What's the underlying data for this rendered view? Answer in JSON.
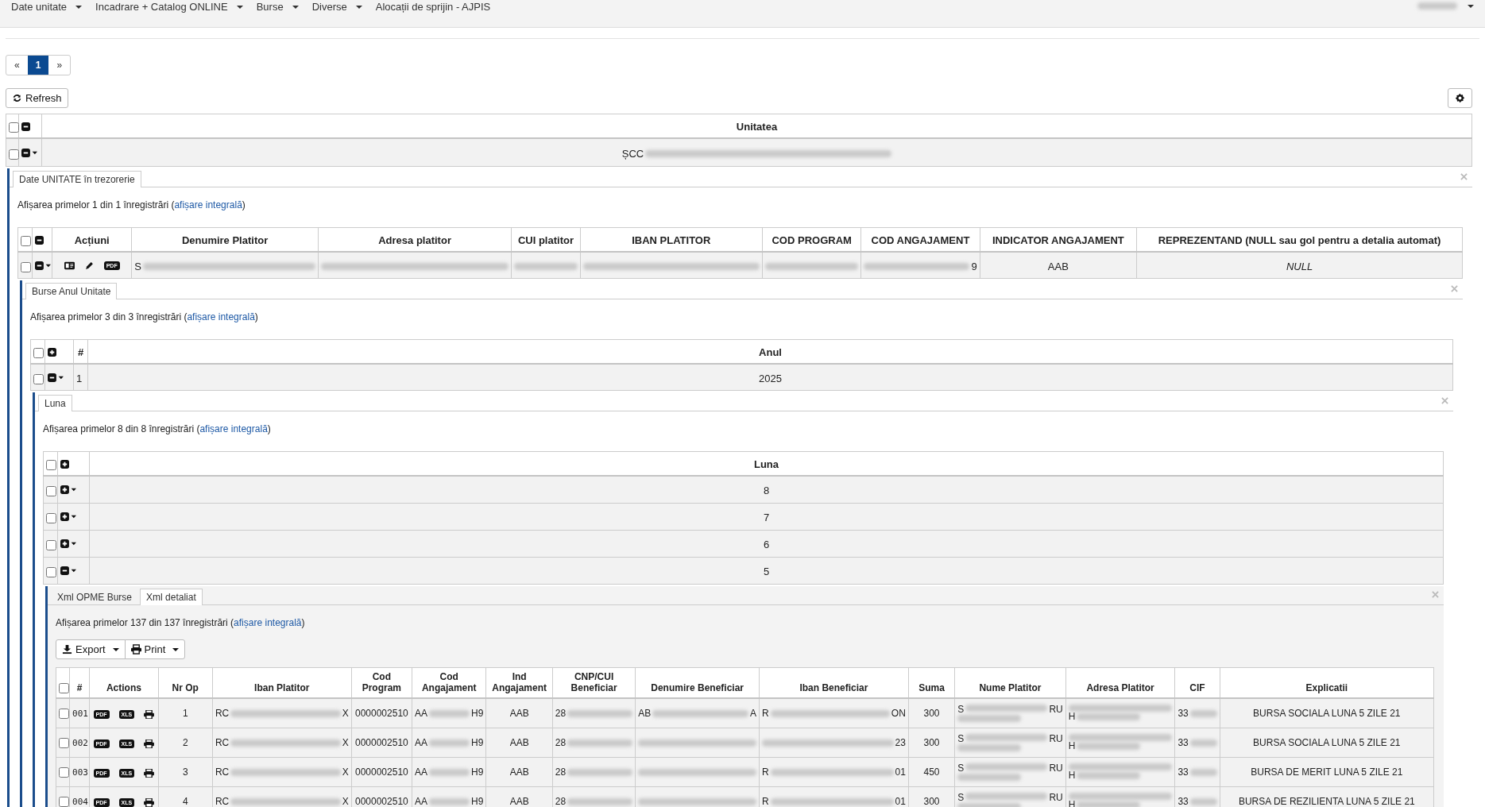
{
  "nav": {
    "items": [
      {
        "label": "Date unitate",
        "dropdown": true
      },
      {
        "label": "Incadrare + Catalog ONLINE",
        "dropdown": true
      },
      {
        "label": "Burse",
        "dropdown": true
      },
      {
        "label": "Diverse",
        "dropdown": true
      },
      {
        "label": "Alocații de sprijin - AJPIS",
        "dropdown": false
      }
    ],
    "user_menu": {
      "dropdown": true
    }
  },
  "pagination": {
    "prev": "«",
    "pages": [
      {
        "label": "1",
        "selected": true
      }
    ],
    "next": "»"
  },
  "toolbar": {
    "refresh": "Refresh"
  },
  "units_table": {
    "header_checked": false,
    "all_expanded": true,
    "columns": [
      "Unitatea"
    ],
    "rows": [
      {
        "checked": false,
        "expanded": true,
        "cells": [
          {
            "kind": "redacted",
            "pre": "ȘCC"
          }
        ]
      }
    ]
  },
  "unit_panel": {
    "tabs": [
      {
        "label": "Date UNITATE în trezorerie",
        "selected": true
      }
    ],
    "summary": {
      "before": "Afișarea primelor 1 din 1 înregistrări (",
      "link": "afișare integrală",
      "after": ")"
    },
    "table": {
      "header_checked": false,
      "all_expanded": true,
      "columns": [
        "Acțiuni",
        "Denumire Platitor",
        "Adresa platitor",
        "CUI platitor",
        "IBAN PLATITOR",
        "COD PROGRAM",
        "COD ANGAJAMENT",
        "INDICATOR ANGAJAMENT",
        "REPREZENTAND (NULL sau gol pentru a detalia automat)"
      ],
      "rows": [
        {
          "checked": false,
          "expanded": true,
          "cells": [
            {
              "kind": "actions",
              "actions": [
                {
                  "kind": "card"
                },
                {
                  "kind": "edit"
                },
                {
                  "kind": "badge",
                  "label": "PDF"
                }
              ]
            },
            {
              "kind": "redacted",
              "pre": "S"
            },
            {
              "kind": "redacted"
            },
            {
              "kind": "redacted"
            },
            {
              "kind": "redacted"
            },
            {
              "kind": "redacted"
            },
            {
              "kind": "redacted",
              "post": "9"
            },
            {
              "kind": "text",
              "text": "AAB"
            },
            {
              "kind": "null",
              "text": "NULL"
            }
          ]
        }
      ]
    },
    "year_panel": {
      "tabs": [
        {
          "label": "Burse Anul Unitate",
          "selected": true
        }
      ],
      "summary": {
        "before": "Afișarea primelor 3 din 3 înregistrări (",
        "link": "afișare integrală",
        "after": ")"
      },
      "table": {
        "header_checked": false,
        "all_expanded": false,
        "columns": [
          "#",
          "Anul"
        ],
        "rows": [
          {
            "checked": false,
            "expanded": true,
            "cells": [
              "1",
              "2025"
            ]
          }
        ]
      },
      "month_panel": {
        "tabs": [
          {
            "label": "Luna",
            "selected": true
          }
        ],
        "summary": {
          "before": "Afișarea primelor 8 din 8 înregistrări (",
          "link": "afișare integrală",
          "after": ")"
        },
        "table": {
          "header_checked": false,
          "all_expanded": false,
          "columns": [
            "Luna"
          ],
          "rows": [
            {
              "checked": false,
              "expanded": false,
              "cells": [
                "8"
              ]
            },
            {
              "checked": false,
              "expanded": false,
              "cells": [
                "7"
              ]
            },
            {
              "checked": false,
              "expanded": false,
              "cells": [
                "6"
              ]
            },
            {
              "checked": false,
              "expanded": true,
              "cells": [
                "5"
              ]
            }
          ]
        },
        "xml_panel": {
          "tabs": [
            {
              "label": "Xml OPME Burse",
              "selected": false
            },
            {
              "label": "Xml detaliat",
              "selected": true
            }
          ],
          "summary": {
            "before": "Afișarea primelor 137 din 137 înregistrări (",
            "link": "afișare integrală",
            "after": ")"
          },
          "buttons": [
            {
              "kind": "export",
              "label": "Export"
            },
            {
              "kind": "print",
              "label": "Print"
            }
          ],
          "table": {
            "header_checked": false,
            "columns": [
              "#",
              "Actions",
              "Nr Op",
              "Iban Platitor",
              "Cod Program",
              "Cod Angajament",
              "Ind Angajament",
              "CNP/CUI Beneficiar",
              "Denumire Beneficiar",
              "Iban Beneficiar",
              "Suma",
              "Nume Platitor",
              "Adresa Platitor",
              "CIF",
              "Explicatii"
            ],
            "rows": [
              {
                "checked": false,
                "cells": [
                  {
                    "kind": "index",
                    "text": "001"
                  },
                  {
                    "kind": "actions",
                    "actions": [
                      {
                        "kind": "badge",
                        "label": "PDF"
                      },
                      {
                        "kind": "badge",
                        "label": "XLS"
                      },
                      {
                        "kind": "print"
                      }
                    ]
                  },
                  {
                    "kind": "text",
                    "text": "1"
                  },
                  {
                    "kind": "redacted",
                    "pre": "RC",
                    "post": "X"
                  },
                  {
                    "kind": "text",
                    "text": "0000002510"
                  },
                  {
                    "kind": "redacted",
                    "pre": "AA",
                    "post": "H9"
                  },
                  {
                    "kind": "text",
                    "text": "AAB"
                  },
                  {
                    "kind": "redacted",
                    "pre": "28"
                  },
                  {
                    "kind": "redacted",
                    "pre": "AB",
                    "post": "A"
                  },
                  {
                    "kind": "redacted",
                    "pre": "R",
                    "post": "ON"
                  },
                  {
                    "kind": "text",
                    "text": "300"
                  },
                  {
                    "kind": "redacted_two_line",
                    "pre": "S",
                    "post": "RU"
                  },
                  {
                    "kind": "redacted_two_line",
                    "pre2": "H"
                  },
                  {
                    "kind": "redacted",
                    "pre": "33"
                  },
                  {
                    "kind": "text",
                    "text": "BURSA SOCIALA LUNA 5 ZILE 21"
                  }
                ]
              },
              {
                "checked": false,
                "cells": [
                  {
                    "kind": "index",
                    "text": "002"
                  },
                  {
                    "kind": "actions",
                    "actions": [
                      {
                        "kind": "badge",
                        "label": "PDF"
                      },
                      {
                        "kind": "badge",
                        "label": "XLS"
                      },
                      {
                        "kind": "print"
                      }
                    ]
                  },
                  {
                    "kind": "text",
                    "text": "2"
                  },
                  {
                    "kind": "redacted",
                    "pre": "RC",
                    "post": "X"
                  },
                  {
                    "kind": "text",
                    "text": "0000002510"
                  },
                  {
                    "kind": "redacted",
                    "pre": "AA",
                    "post": "H9"
                  },
                  {
                    "kind": "text",
                    "text": "AAB"
                  },
                  {
                    "kind": "redacted",
                    "pre": "28"
                  },
                  {
                    "kind": "redacted"
                  },
                  {
                    "kind": "redacted",
                    "post": "23"
                  },
                  {
                    "kind": "text",
                    "text": "300"
                  },
                  {
                    "kind": "redacted_two_line",
                    "pre": "S",
                    "post": "RU"
                  },
                  {
                    "kind": "redacted_two_line",
                    "pre2": "H"
                  },
                  {
                    "kind": "redacted",
                    "pre": "33"
                  },
                  {
                    "kind": "text",
                    "text": "BURSA SOCIALA LUNA 5 ZILE 21"
                  }
                ]
              },
              {
                "checked": false,
                "cells": [
                  {
                    "kind": "index",
                    "text": "003"
                  },
                  {
                    "kind": "actions",
                    "actions": [
                      {
                        "kind": "badge",
                        "label": "PDF"
                      },
                      {
                        "kind": "badge",
                        "label": "XLS"
                      },
                      {
                        "kind": "print"
                      }
                    ]
                  },
                  {
                    "kind": "text",
                    "text": "3"
                  },
                  {
                    "kind": "redacted",
                    "pre": "RC",
                    "post": "X"
                  },
                  {
                    "kind": "text",
                    "text": "0000002510"
                  },
                  {
                    "kind": "redacted",
                    "pre": "AA",
                    "post": "H9"
                  },
                  {
                    "kind": "text",
                    "text": "AAB"
                  },
                  {
                    "kind": "redacted",
                    "pre": "28"
                  },
                  {
                    "kind": "redacted"
                  },
                  {
                    "kind": "redacted",
                    "pre": "R",
                    "post": "01"
                  },
                  {
                    "kind": "text",
                    "text": "450"
                  },
                  {
                    "kind": "redacted_two_line",
                    "pre": "S",
                    "post": "RU"
                  },
                  {
                    "kind": "redacted_two_line",
                    "pre2": "H"
                  },
                  {
                    "kind": "redacted",
                    "pre": "33"
                  },
                  {
                    "kind": "text",
                    "text": "BURSA DE MERIT LUNA 5 ZILE 21"
                  }
                ]
              },
              {
                "checked": false,
                "cells": [
                  {
                    "kind": "index",
                    "text": "004"
                  },
                  {
                    "kind": "actions",
                    "actions": [
                      {
                        "kind": "badge",
                        "label": "PDF"
                      },
                      {
                        "kind": "badge",
                        "label": "XLS"
                      },
                      {
                        "kind": "print"
                      }
                    ]
                  },
                  {
                    "kind": "text",
                    "text": "4"
                  },
                  {
                    "kind": "redacted",
                    "pre": "RC",
                    "post": "X"
                  },
                  {
                    "kind": "text",
                    "text": "0000002510"
                  },
                  {
                    "kind": "redacted",
                    "pre": "AA",
                    "post": "H9"
                  },
                  {
                    "kind": "text",
                    "text": "AAB"
                  },
                  {
                    "kind": "redacted",
                    "pre": "28"
                  },
                  {
                    "kind": "redacted"
                  },
                  {
                    "kind": "redacted",
                    "pre": "R",
                    "post": "01"
                  },
                  {
                    "kind": "text",
                    "text": "300"
                  },
                  {
                    "kind": "redacted_two_line",
                    "pre": "S",
                    "post": "RU"
                  },
                  {
                    "kind": "redacted_two_line",
                    "pre2": "H"
                  },
                  {
                    "kind": "redacted",
                    "pre": "33"
                  },
                  {
                    "kind": "text",
                    "text": "BURSA DE REZILIENTA LUNA 5 ZILE 21"
                  }
                ]
              }
            ]
          }
        }
      }
    }
  }
}
